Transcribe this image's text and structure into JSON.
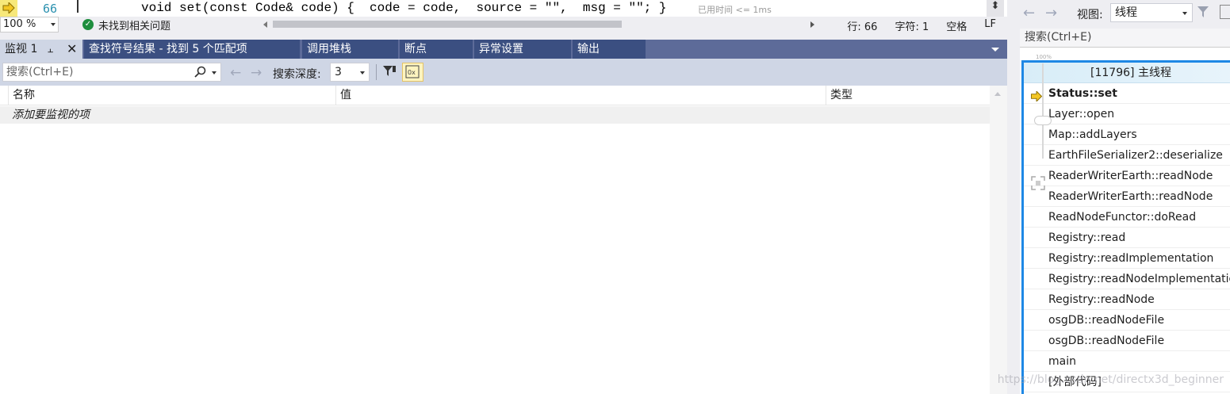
{
  "code": {
    "line_number": "66",
    "text": "void set(const Code& code) {  code = code,  source = \"\",  msg = \"\"; }",
    "elapsed": "已用时间 <= 1ms"
  },
  "status": {
    "zoom": "100 %",
    "issues": "未找到相关问题",
    "line": "行: 66",
    "char": "字符: 1",
    "whitespace": "空格",
    "eol": "LF"
  },
  "tabs": [
    {
      "label": "监视 1"
    },
    {
      "label": "查找符号结果 - 找到 5 个匹配项"
    },
    {
      "label": "调用堆栈"
    },
    {
      "label": "断点"
    },
    {
      "label": "异常设置"
    },
    {
      "label": "输出"
    }
  ],
  "watch": {
    "search_placeholder": "搜索(Ctrl+E)",
    "depth_label": "搜索深度:",
    "depth_value": "3",
    "columns": [
      "名称",
      "值",
      "类型"
    ],
    "add_item_text": "添加要监视的项"
  },
  "stacks": {
    "view_label": "视图:",
    "view_value": "线程",
    "search_placeholder": "搜索(Ctrl+E)",
    "zoom_percent": "100%",
    "thread_title": "[11796] 主线程",
    "frames": [
      "Status::set",
      "Layer::open",
      "Map::addLayers",
      "EarthFileSerializer2::deserialize",
      "ReaderWriterEarth::readNode",
      "ReaderWriterEarth::readNode",
      "ReadNodeFunctor::doRead",
      "Registry::read",
      "Registry::readImplementation",
      "Registry::readNodeImplementation",
      "Registry::readNode",
      "osgDB::readNodeFile",
      "osgDB::readNodeFile",
      "main",
      "[外部代码]"
    ]
  },
  "watermark": "https://blog.csdn.net/directx3d_beginner",
  "colors": {
    "tab_active": "#cfd6e5",
    "tab_inactive": "#3b4f81",
    "tabbar": "#5d6b99",
    "node_border": "#1e88e5"
  }
}
